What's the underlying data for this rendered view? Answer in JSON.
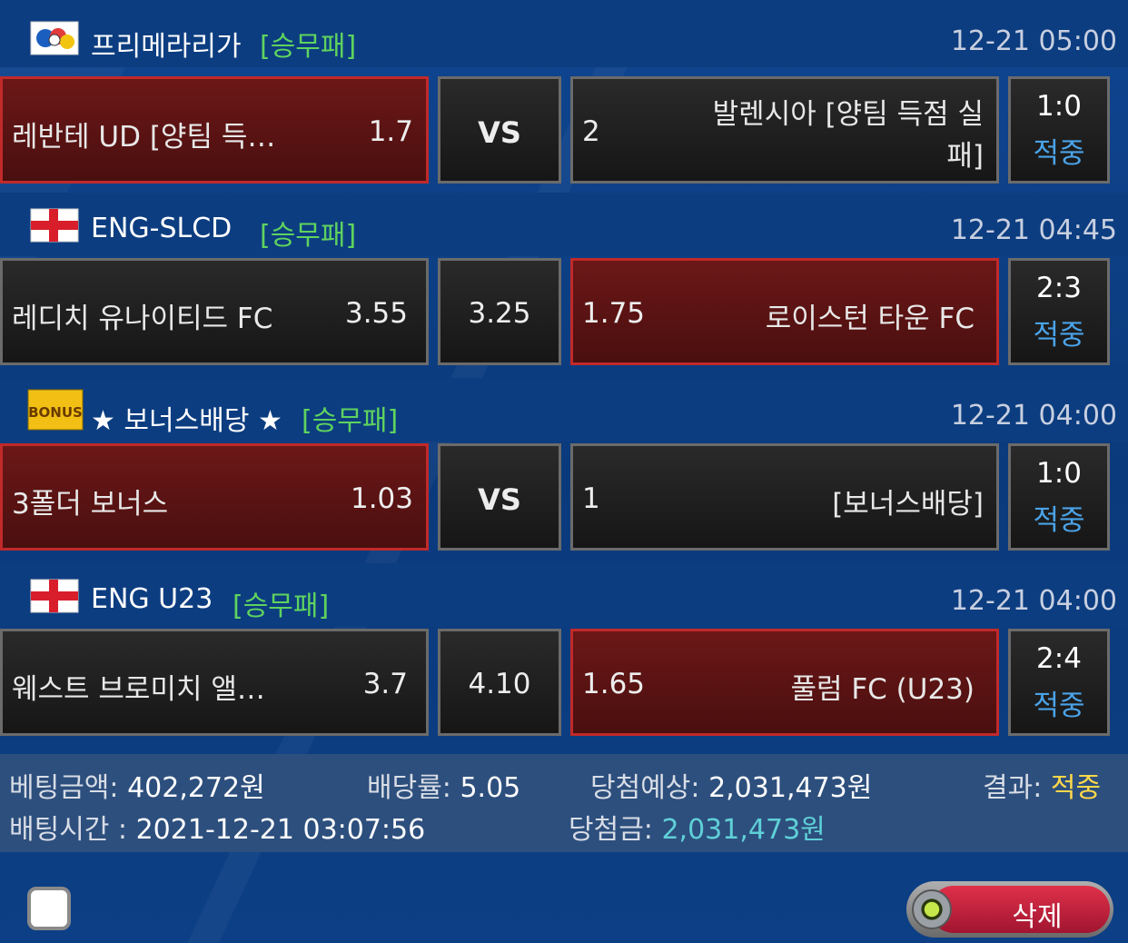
{
  "matches": [
    {
      "league": "프리메라리가",
      "bet_type": "[승무패]",
      "time": "12-21 05:00",
      "home_team": "레반테 UD [양팀 득…",
      "home_odds": "1.7",
      "draw": "VS",
      "away_odds": "2",
      "away_team": "발렌시아 [양팀 득점 실패]",
      "score": "1:0",
      "result": "적중",
      "selected": "home"
    },
    {
      "league": "ENG-SLCD",
      "bet_type": "[승무패]",
      "time": "12-21 04:45",
      "home_team": "레디치 유나이티드 FC",
      "home_odds": "3.55",
      "draw": "3.25",
      "away_odds": "1.75",
      "away_team": "로이스턴 타운 FC",
      "score": "2:3",
      "result": "적중",
      "selected": "away"
    },
    {
      "league": "★ 보너스배당 ★",
      "bet_type": "[승무패]",
      "time": "12-21 04:00",
      "home_team": "3폴더 보너스",
      "home_odds": "1.03",
      "draw": "VS",
      "away_odds": "1",
      "away_team": "[보너스배당]",
      "score": "1:0",
      "result": "적중",
      "selected": "home",
      "badge_text": "BONUS"
    },
    {
      "league": "ENG U23",
      "bet_type": "[승무패]",
      "time": "12-21 04:00",
      "home_team": "웨스트 브로미치 앨…",
      "home_odds": "3.7",
      "draw": "4.10",
      "away_odds": "1.65",
      "away_team": "풀럼 FC (U23)",
      "score": "2:4",
      "result": "적중",
      "selected": "away"
    }
  ],
  "summary": {
    "bet_amount_label": "베팅금액:",
    "bet_amount": "402,272원",
    "odds_label": "배당률:",
    "odds": "5.05",
    "expected_label": "당첨예상:",
    "expected": "2,031,473원",
    "result_label": "결과:",
    "result": "적중",
    "bet_time_label": "배팅시간 :",
    "bet_time": "2021-12-21 03:07:56",
    "winnings_label": "당첨금:",
    "winnings": "2,031,473원"
  },
  "actions": {
    "delete_label": "삭제"
  },
  "colors": {
    "bet_type": "#5fd35f",
    "result": "#4aa3e8",
    "selected": "#6c1717",
    "winnings": "#5fd0d8",
    "final_result": "#ffd84a"
  }
}
